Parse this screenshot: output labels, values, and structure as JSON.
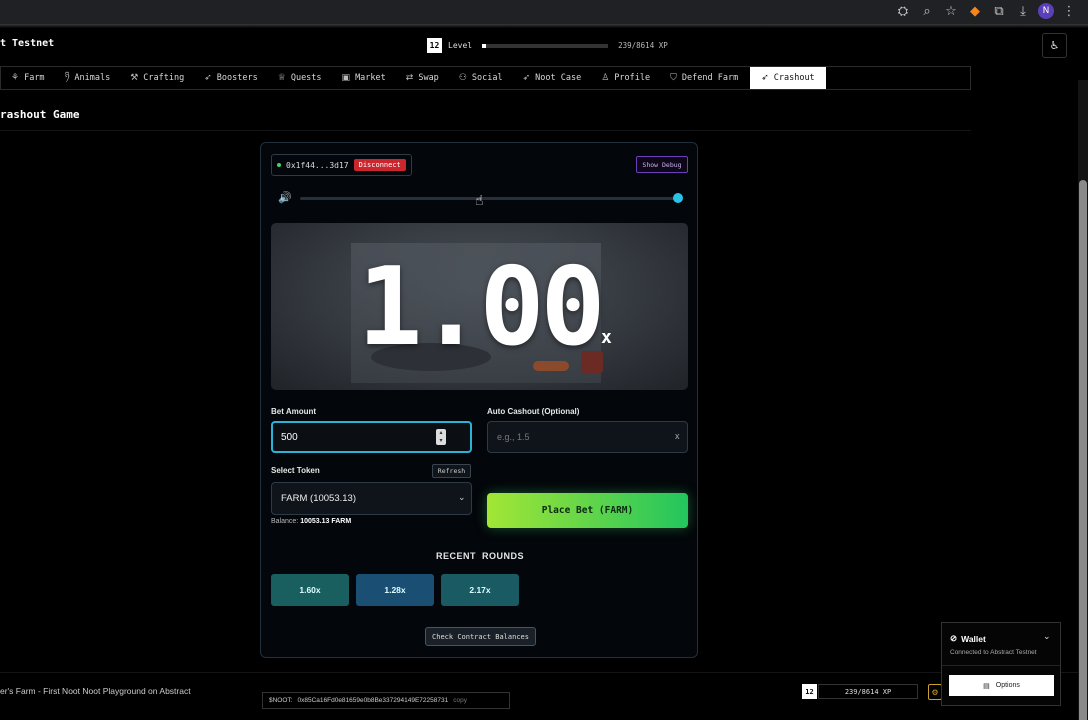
{
  "header": {
    "app_title": "t Testnet",
    "level": "12",
    "level_label": "Level",
    "xp_text": "239/8614 XP",
    "xp_fraction": 0.028
  },
  "nav": {
    "items": [
      {
        "label": "Farm",
        "icon": "leaf-icon"
      },
      {
        "label": "Animals",
        "icon": "paw-icon"
      },
      {
        "label": "Crafting",
        "icon": "hammer-icon"
      },
      {
        "label": "Boosters",
        "icon": "rocket-icon"
      },
      {
        "label": "Quests",
        "icon": "trophy-icon"
      },
      {
        "label": "Market",
        "icon": "store-icon"
      },
      {
        "label": "Swap",
        "icon": "swap-icon"
      },
      {
        "label": "Social",
        "icon": "users-icon"
      },
      {
        "label": "Noot Case",
        "icon": "rocket-icon"
      },
      {
        "label": "Profile",
        "icon": "user-icon"
      },
      {
        "label": "Defend Farm",
        "icon": "shield-icon"
      },
      {
        "label": "Crashout",
        "icon": "rocket-icon"
      }
    ],
    "active": "Crashout"
  },
  "page": {
    "title": "rashout Game"
  },
  "game": {
    "wallet_address": "0x1f44...3d17",
    "disconnect_label": "Disconnect",
    "debug_label": "Show Debug",
    "volume_level": 1.0,
    "multiplier": "1.00",
    "multiplier_suffix": "x",
    "bet_amount_label": "Bet Amount",
    "bet_amount_value": "500",
    "auto_cashout_label": "Auto Cashout (Optional)",
    "auto_cashout_placeholder": "e.g., 1.5",
    "clear_label": "x",
    "select_token_label": "Select Token",
    "refresh_label": "Refresh",
    "token_selected": "FARM (10053.13)",
    "balance_prefix": "Balance:",
    "balance_value": "10053.13 FARM",
    "place_bet_label": "Place Bet (FARM)",
    "recent_title": "RECENT  ROUNDS",
    "recent_rounds": [
      "1.60x",
      "1.28x",
      "2.17x"
    ],
    "round_colors": [
      "#1a5f60",
      "#1a4f73",
      "#1a5a63"
    ],
    "check_balances_label": "Check Contract Balances"
  },
  "footer": {
    "title": "er's Farm - First Noot Noot Playground on Abstract",
    "contract_label": "$NOOT:",
    "contract_address": "0x85Ca16Fd0e81659e0b8Be337294149E72258731",
    "copy_label": "copy",
    "level": "12",
    "xp_text": "239/8614 XP"
  },
  "wallet_popup": {
    "title": "Wallet",
    "subtitle": "Connected to Abstract Testnet",
    "options_label": "Options"
  },
  "colors": {
    "accent": "#29c3e8",
    "bet_gradient_start": "#a3e635",
    "bet_gradient_end": "#22c55e",
    "disconnect": "#c9262d",
    "debug_border": "#6c3fb8"
  }
}
